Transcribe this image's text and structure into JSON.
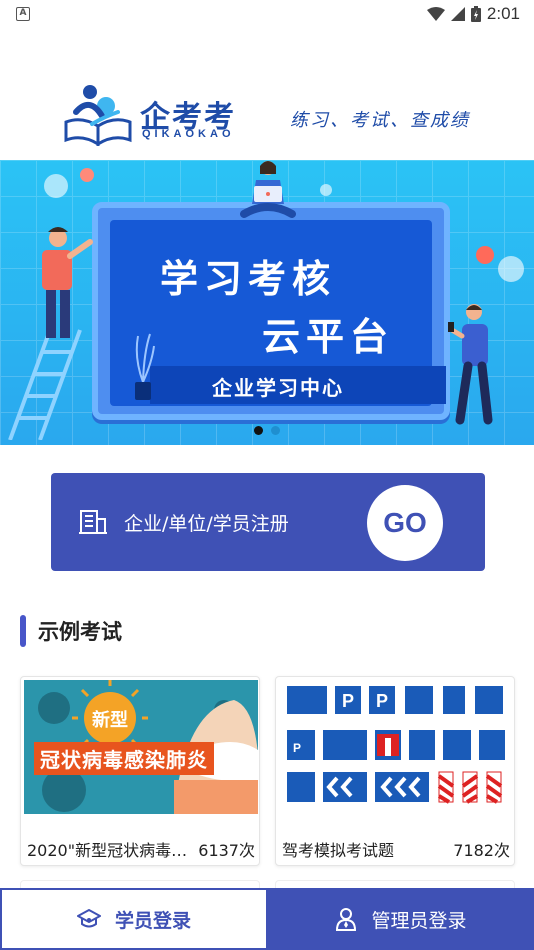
{
  "status_bar": {
    "time": "2:01"
  },
  "header": {
    "brand_name": "企考考",
    "brand_sub": "QIKAOKAO",
    "slogan": "练习、考试、查成绩"
  },
  "banner": {
    "line1": "学习考核",
    "line2": "云平台",
    "bar_text": "企业学习中心",
    "dots": 2,
    "active_dot": 0
  },
  "register": {
    "label": "企业/单位/学员注册",
    "go_label": "GO"
  },
  "section": {
    "title": "示例考试"
  },
  "exams": [
    {
      "title": "2020\"新型冠状病毒…",
      "count": "6137次",
      "thumb_badge": "新型",
      "thumb_text": "冠状病毒感染肺炎"
    },
    {
      "title": "驾考模拟考试题",
      "count": "7182次"
    }
  ],
  "bottom_nav": {
    "student_login": "学员登录",
    "admin_login": "管理员登录"
  },
  "colors": {
    "primary": "#3f51b5",
    "brand_blue": "#1f4ca8",
    "banner_sky": "#2bc3f5"
  }
}
